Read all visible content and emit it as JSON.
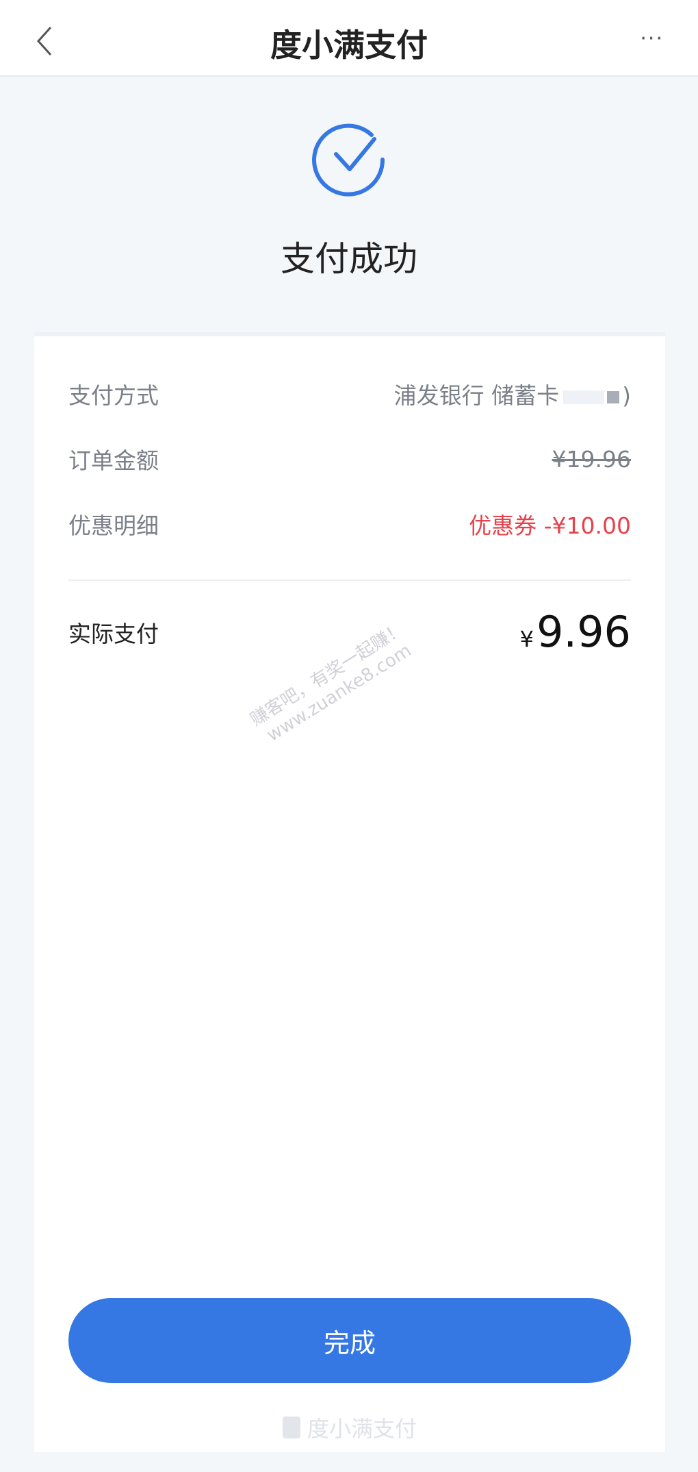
{
  "header": {
    "title": "度小满支付",
    "back_icon": "chevron-left-icon",
    "more_icon": "more-icon",
    "more_label": "···"
  },
  "status": {
    "icon": "check-circle-icon",
    "text": "支付成功",
    "accent": "#3578e3"
  },
  "details": {
    "payment_method": {
      "label": "支付方式",
      "value": "浦发银行 储蓄卡",
      "suffix": ")"
    },
    "order_amount": {
      "label": "订单金额",
      "value": "¥19.96"
    },
    "discount": {
      "label": "优惠明细",
      "value": "优惠券 -¥10.00",
      "color": "#e8414a"
    },
    "actual": {
      "label": "实际支付",
      "currency": "¥",
      "value": "9.96"
    }
  },
  "watermark": {
    "line1": "赚客吧，有奖一起赚！",
    "line2": "www.zuanke8.com"
  },
  "done_button": {
    "label": "完成"
  },
  "footer": {
    "brand": "度小满支付"
  }
}
